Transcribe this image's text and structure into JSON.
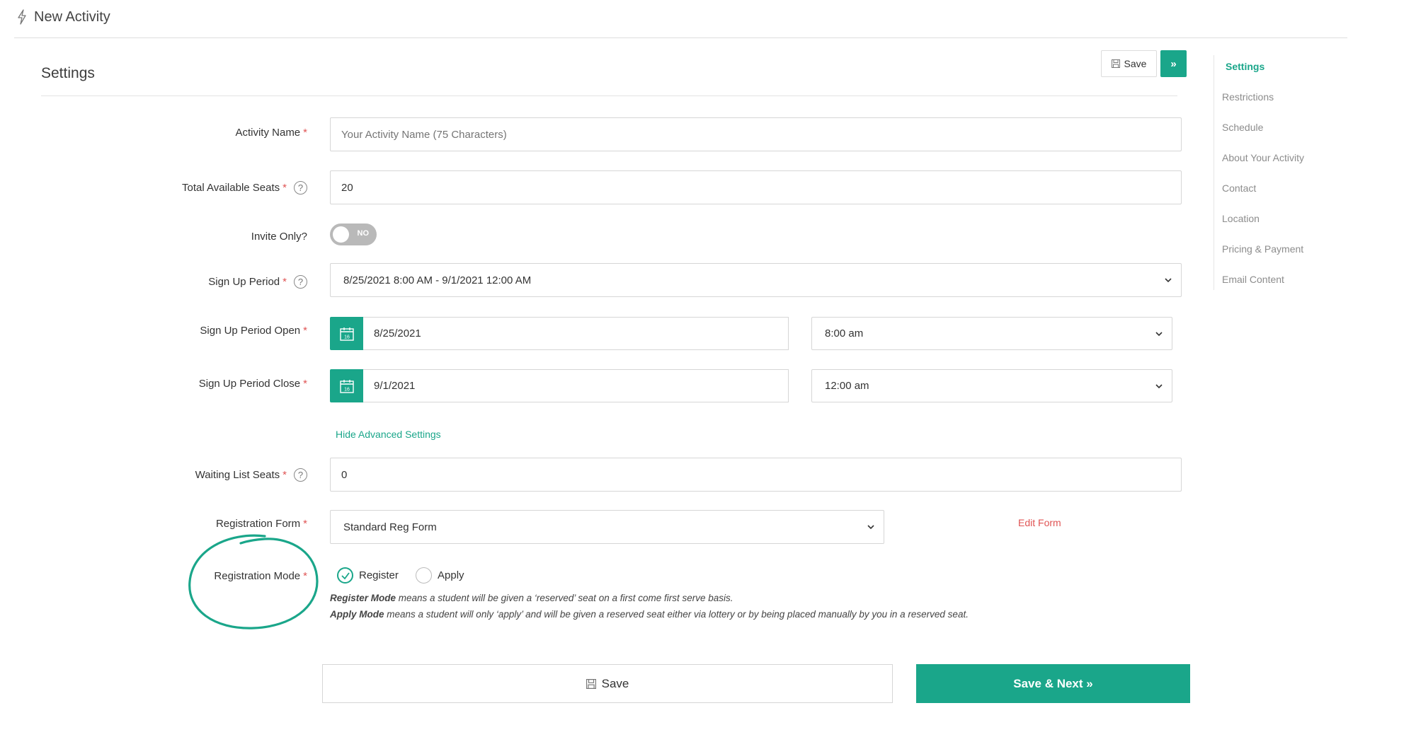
{
  "header": {
    "title": "New Activity",
    "icon": "bolt-icon"
  },
  "section": {
    "title": "Settings"
  },
  "toolbar": {
    "save_label": "Save",
    "next_label": "»"
  },
  "nav": {
    "items": [
      {
        "label": "Settings",
        "active": true
      },
      {
        "label": "Restrictions"
      },
      {
        "label": "Schedule"
      },
      {
        "label": "About Your Activity"
      },
      {
        "label": "Contact"
      },
      {
        "label": "Location"
      },
      {
        "label": "Pricing & Payment"
      },
      {
        "label": "Email Content"
      }
    ]
  },
  "form": {
    "activity_name": {
      "label": "Activity Name",
      "required": "*",
      "placeholder": "Your Activity Name (75 Characters)",
      "value": ""
    },
    "total_seats": {
      "label": "Total Available Seats",
      "required": "*",
      "value": "20",
      "help": "?"
    },
    "invite_only": {
      "label": "Invite Only?",
      "toggle_text": "NO",
      "on": false
    },
    "signup_period": {
      "label": "Sign Up Period",
      "required": "*",
      "help": "?",
      "value": "8/25/2021 8:00 AM - 9/1/2021 12:00 AM"
    },
    "signup_open": {
      "label": "Sign Up Period Open",
      "required": "*",
      "date": "8/25/2021",
      "time": "8:00 am",
      "cal_day": "16"
    },
    "signup_close": {
      "label": "Sign Up Period Close",
      "required": "*",
      "date": "9/1/2021",
      "time": "12:00 am",
      "cal_day": "16"
    },
    "advanced_toggle": "Hide Advanced Settings",
    "waiting_list": {
      "label": "Waiting List Seats",
      "required": "*",
      "help": "?",
      "value": "0"
    },
    "registration_form": {
      "label": "Registration Form",
      "required": "*",
      "value": "Standard Reg Form",
      "edit_label": "Edit Form"
    },
    "registration_mode": {
      "label": "Registration Mode",
      "required": "*",
      "options": [
        {
          "label": "Register",
          "checked": true
        },
        {
          "label": "Apply",
          "checked": false
        }
      ],
      "note_register_title": "Register Mode",
      "note_register_text": " means a student will be given a ‘reserved’ seat on a first come first serve basis.",
      "note_apply_title": "Apply Mode",
      "note_apply_text": " means a student will only ‘apply’ and will be given a reserved seat either via lottery or by being placed manually by you in a reserved seat."
    }
  },
  "footer": {
    "save_label": "Save",
    "save_next_label": "Save & Next »"
  },
  "colors": {
    "accent": "#1aa68a",
    "required": "#e05454",
    "link_red": "#e05454"
  }
}
